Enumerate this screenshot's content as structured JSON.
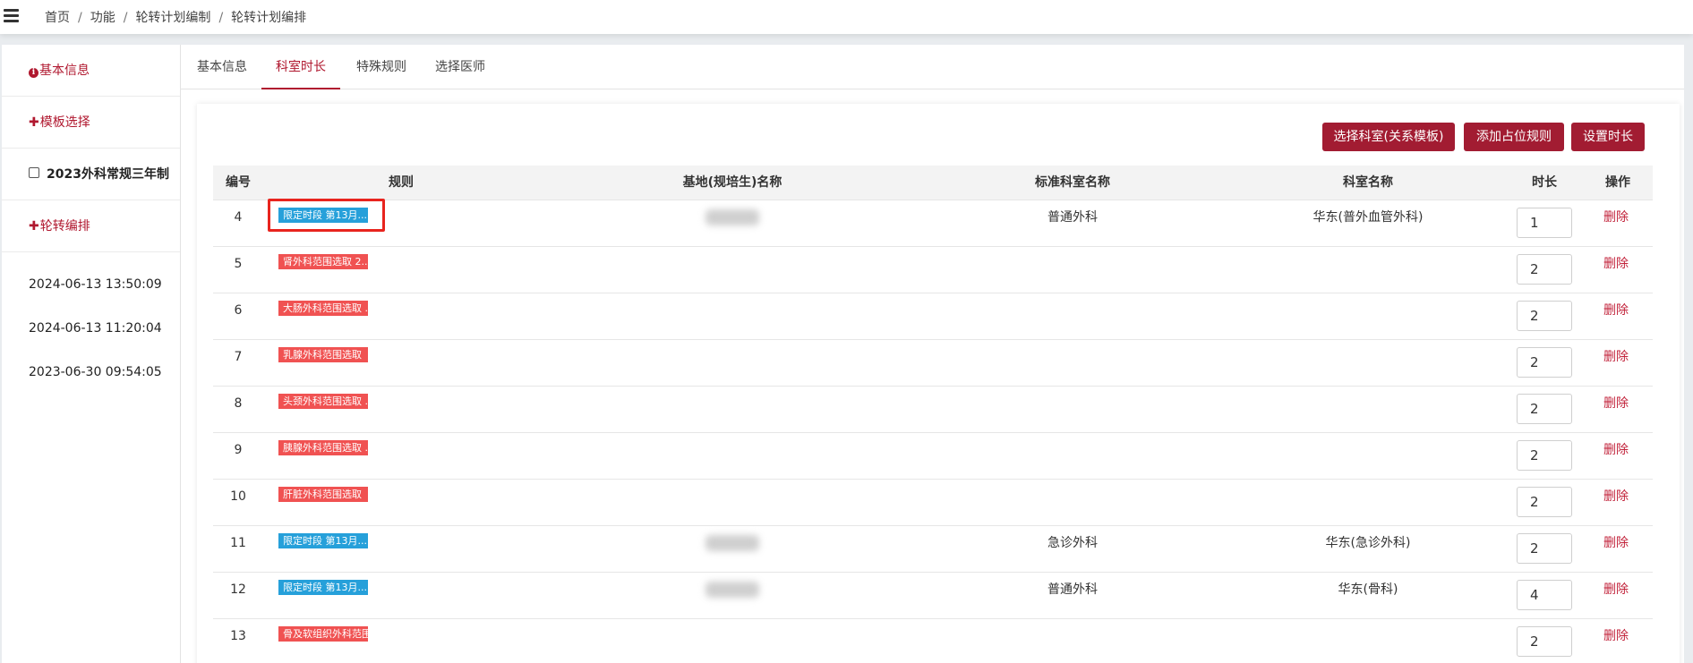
{
  "breadcrumb": {
    "items": [
      "首页",
      "功能",
      "轮转计划编制",
      "轮转计划编排"
    ],
    "separator": "/"
  },
  "sidebar": {
    "basic_info": "基本信息",
    "template_select": "模板选择",
    "template_name": "2023外科常规三年制",
    "rotation": "轮转编排",
    "timestamps": [
      "2024-06-13 13:50:09",
      "2024-06-13 11:20:04",
      "2023-06-30 09:54:05"
    ]
  },
  "tabs": [
    {
      "label": "基本信息",
      "active": false
    },
    {
      "label": "科室时长",
      "active": true
    },
    {
      "label": "特殊规则",
      "active": false
    },
    {
      "label": "选择医师",
      "active": false
    }
  ],
  "toolbar": {
    "select_dept": "选择科室(关系模板)",
    "add_rule": "添加占位规则",
    "set_duration": "设置时长"
  },
  "table": {
    "headers": {
      "no": "编号",
      "rule": "规则",
      "base": "基地(规培生)名称",
      "std_dept": "标准科室名称",
      "dept": "科室名称",
      "duration": "时长",
      "action": "操作"
    },
    "delete_label": "删除",
    "rows": [
      {
        "no": "4",
        "rule": "限定时段 第13月...",
        "rule_color": "blue",
        "std_dept": "普通外科",
        "dept": "华东(普外血管外科)",
        "duration": "1",
        "highlighted": true
      },
      {
        "no": "5",
        "rule": "肾外科范围选取 2...",
        "rule_color": "red",
        "std_dept": "",
        "dept": "",
        "duration": "2",
        "highlighted": false
      },
      {
        "no": "6",
        "rule": "大肠外科范围选取 ...",
        "rule_color": "red",
        "std_dept": "",
        "dept": "",
        "duration": "2",
        "highlighted": false
      },
      {
        "no": "7",
        "rule": "乳腺外科范围选取",
        "rule_color": "red",
        "std_dept": "",
        "dept": "",
        "duration": "2",
        "highlighted": false
      },
      {
        "no": "8",
        "rule": "头颈外科范围选取 ...",
        "rule_color": "red",
        "std_dept": "",
        "dept": "",
        "duration": "2",
        "highlighted": false
      },
      {
        "no": "9",
        "rule": "胰腺外科范围选取 ...",
        "rule_color": "red",
        "std_dept": "",
        "dept": "",
        "duration": "2",
        "highlighted": false
      },
      {
        "no": "10",
        "rule": "肝脏外科范围选取",
        "rule_color": "red",
        "std_dept": "",
        "dept": "",
        "duration": "2",
        "highlighted": false
      },
      {
        "no": "11",
        "rule": "限定时段 第13月...",
        "rule_color": "blue",
        "std_dept": "急诊外科",
        "dept": "华东(急诊外科)",
        "duration": "2",
        "highlighted": false
      },
      {
        "no": "12",
        "rule": "限定时段 第13月...",
        "rule_color": "blue",
        "std_dept": "普通外科",
        "dept": "华东(骨科)",
        "duration": "4",
        "highlighted": false
      },
      {
        "no": "13",
        "rule": "骨及软组织外科范围",
        "rule_color": "red",
        "std_dept": "",
        "dept": "",
        "duration": "2",
        "highlighted": false
      }
    ]
  },
  "colors": {
    "accent": "#a21c32",
    "tag_blue": "#26a0da",
    "tag_red": "#f05252",
    "highlight": "#e8241e"
  }
}
